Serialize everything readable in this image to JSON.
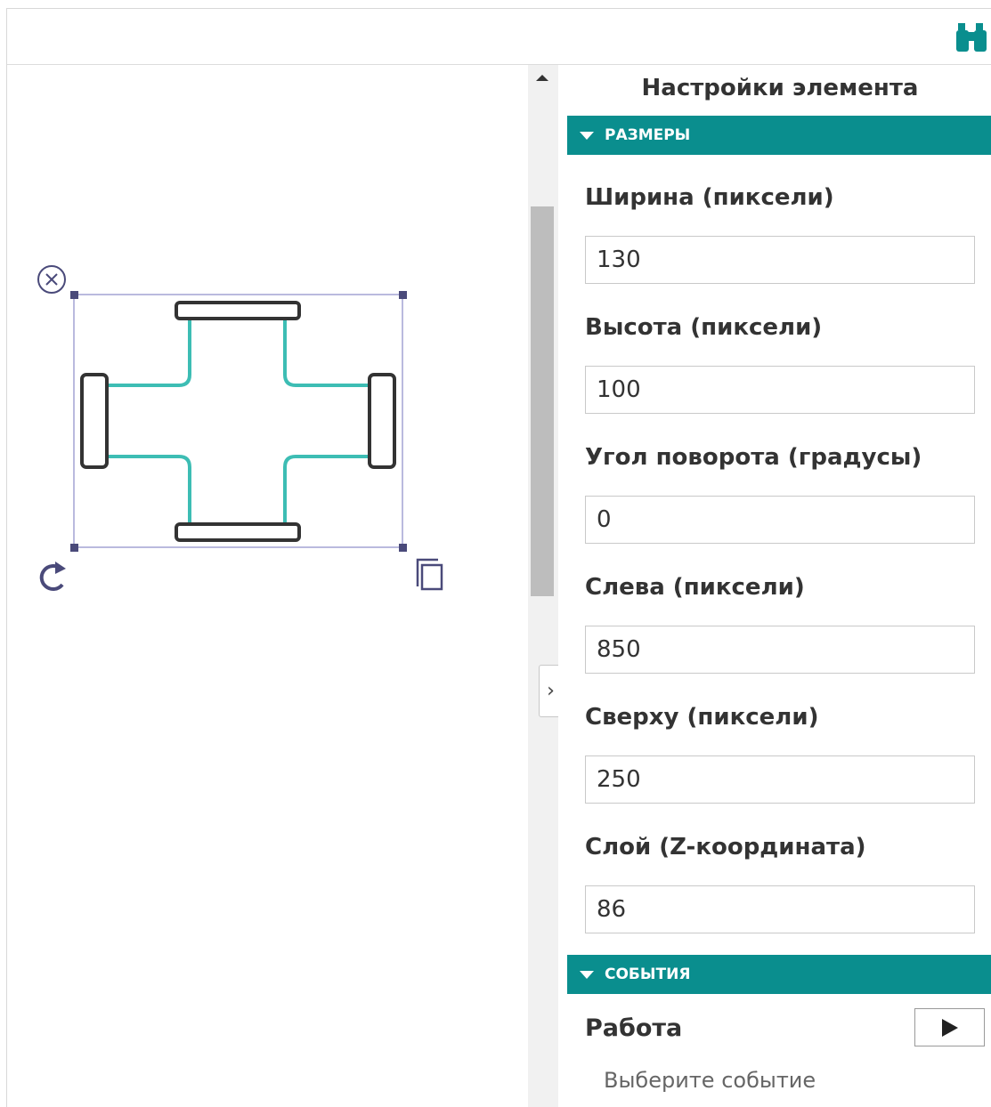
{
  "panel": {
    "title": "Настройки элемента",
    "sections": {
      "sizes": "РАЗМЕРЫ",
      "events": "СОБЫТИЯ"
    },
    "fields": [
      {
        "label": "Ширина (пиксели)",
        "value": "130"
      },
      {
        "label": "Высота (пиксели)",
        "value": "100"
      },
      {
        "label": "Угол поворота (градусы)",
        "value": "0"
      },
      {
        "label": "Слева (пиксели)",
        "value": "850"
      },
      {
        "label": "Сверху (пиксели)",
        "value": "250"
      },
      {
        "label": "Слой (Z-координата)",
        "value": "86"
      }
    ],
    "event": {
      "label": "Работа",
      "select_placeholder": "Выберите событие"
    }
  },
  "icons": {
    "topbar": "binoculars-icon",
    "delete": "close-circle-icon",
    "rotate": "rotate-icon",
    "duplicate": "copy-icon",
    "collapse": "chevron-right-icon",
    "play": "play-icon"
  },
  "colors": {
    "accent": "#0a8e8e",
    "pipe": "#3dbdb4",
    "selection": "#8c8cc8",
    "handle": "#4a4a7a"
  }
}
